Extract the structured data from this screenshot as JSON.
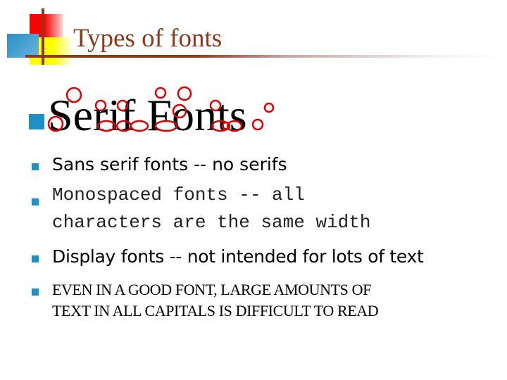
{
  "slide": {
    "title": "Types of fonts",
    "heading": "Serif Fonts",
    "bullets": [
      {
        "lines": [
          "Sans serif fonts -- no serifs"
        ],
        "style": "sans-serif"
      },
      {
        "lines": [
          "Monospaced fonts -- all",
          "characters are the same width"
        ],
        "style": "monospace"
      },
      {
        "lines": [
          "Display fonts -- not intended for lots of text"
        ],
        "style": "display"
      },
      {
        "lines": [
          "EVEN IN A GOOD FONT, LARGE AMOUNTS OF",
          "TEXT IN ALL CAPITALS IS DIFFICULT TO READ"
        ],
        "style": "serif-caps"
      }
    ],
    "colors": {
      "title": "#8b3a1a",
      "bullet": "#1e90c8",
      "serif_markers": "#dd0000"
    }
  }
}
